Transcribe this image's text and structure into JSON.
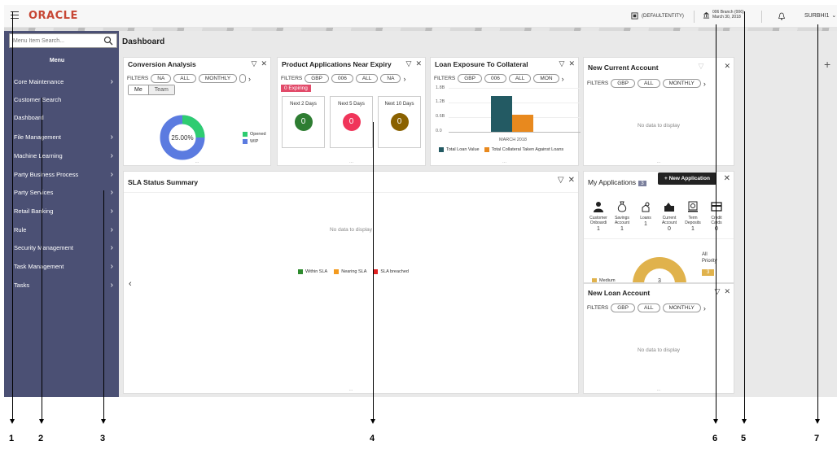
{
  "header": {
    "logo": "ORACLE",
    "entity": "(DEFAULTENTITY)",
    "branch_line1": "006 Branch (006)",
    "branch_line2": "March 30, 2018",
    "user": "SURBHI1"
  },
  "sidebar": {
    "search_placeholder": "Menu Item Search...",
    "menu_title": "Menu",
    "items": [
      {
        "label": "Core Maintenance",
        "chevron": true
      },
      {
        "label": "Customer Search",
        "chevron": false
      },
      {
        "label": "Dashboard",
        "chevron": false
      },
      {
        "label": "File Management",
        "chevron": true
      },
      {
        "label": "Machine Learning",
        "chevron": true
      },
      {
        "label": "Party Business Process",
        "chevron": true
      },
      {
        "label": "Party Services",
        "chevron": true
      },
      {
        "label": "Retail Banking",
        "chevron": true
      },
      {
        "label": "Rule",
        "chevron": true
      },
      {
        "label": "Security Management",
        "chevron": true
      },
      {
        "label": "Task Management",
        "chevron": true
      },
      {
        "label": "Tasks",
        "chevron": true
      }
    ]
  },
  "page": {
    "title": "Dashboard"
  },
  "conversion": {
    "title": "Conversion Analysis",
    "filters_label": "FILTERS",
    "filters": [
      "NA",
      "ALL",
      "MONTHLY"
    ],
    "toggle": [
      "Me",
      "Team"
    ],
    "center_label": "25.00%",
    "legend": [
      {
        "label": "Opened",
        "color": "#2ecc71"
      },
      {
        "label": "WIP",
        "color": "#5b7be0"
      }
    ],
    "opened_fraction": 0.25
  },
  "product_apps": {
    "title": "Product Applications Near Expiry",
    "filters_label": "FILTERS",
    "filters": [
      "GBP",
      "006",
      "ALL",
      "NA"
    ],
    "expiring": "0 Expiring",
    "boxes": [
      {
        "label": "Next 2 Days",
        "value": "0",
        "color": "#2e7d32"
      },
      {
        "label": "Next 5 Days",
        "value": "0",
        "color": "#f0355a"
      },
      {
        "label": "Next 10 Days",
        "value": "0",
        "color": "#8a6100"
      }
    ]
  },
  "loan_exposure": {
    "title": "Loan Exposure To Collateral",
    "filters_label": "FILTERS",
    "filters": [
      "GBP",
      "006",
      "ALL",
      "MON"
    ],
    "y_ticks": [
      "1.8B",
      "1.2B",
      "0.6B",
      "0.0"
    ],
    "x_label": "MARCH 2018",
    "legend": [
      {
        "label": "Total Loan Value",
        "color": "#235a63"
      },
      {
        "label": "Total Collateral Taken Against Loans",
        "color": "#e8891e"
      }
    ]
  },
  "new_current": {
    "title": "New Current Account",
    "filters_label": "FILTERS",
    "filters": [
      "GBP",
      "ALL",
      "MONTHLY"
    ],
    "no_data": "No data to display"
  },
  "sla": {
    "title": "SLA Status Summary",
    "no_data": "No data to display",
    "legend": [
      {
        "label": "Within SLA",
        "color": "#2e8b2e"
      },
      {
        "label": "Nearing SLA",
        "color": "#f39a1e"
      },
      {
        "label": "SLA breached",
        "color": "#e02020"
      }
    ]
  },
  "my_apps": {
    "title": "My Applications",
    "count": "3",
    "new_button": "+ New Application",
    "tiles": [
      {
        "label1": "Customer",
        "label2": "Onboardi",
        "count": "1",
        "icon": "person-icon"
      },
      {
        "label1": "Savings",
        "label2": "Account",
        "count": "1",
        "icon": "money-bag-icon"
      },
      {
        "label1": "Loans",
        "label2": "",
        "count": "1",
        "icon": "loan-icon"
      },
      {
        "label1": "Current",
        "label2": "Account",
        "count": "0",
        "icon": "current-account-icon"
      },
      {
        "label1": "Term",
        "label2": "Deposits",
        "count": "1",
        "icon": "term-deposit-icon"
      },
      {
        "label1": "Credit",
        "label2": "Cards",
        "count": "0",
        "icon": "credit-card-icon"
      }
    ],
    "priority_label": "All Priority",
    "priority_value": "3",
    "donut_value": "3",
    "legend_medium": "Medium"
  },
  "new_loan": {
    "title": "New Loan Account",
    "filters_label": "FILTERS",
    "filters": [
      "GBP",
      "ALL",
      "MONTHLY"
    ],
    "no_data": "No data to display"
  },
  "callouts": [
    "1",
    "2",
    "3",
    "4",
    "6",
    "5",
    "7"
  ],
  "colors": {
    "sidebar": "#4b5074",
    "oracle_red": "#c74634",
    "accent": "#5b7be0"
  }
}
